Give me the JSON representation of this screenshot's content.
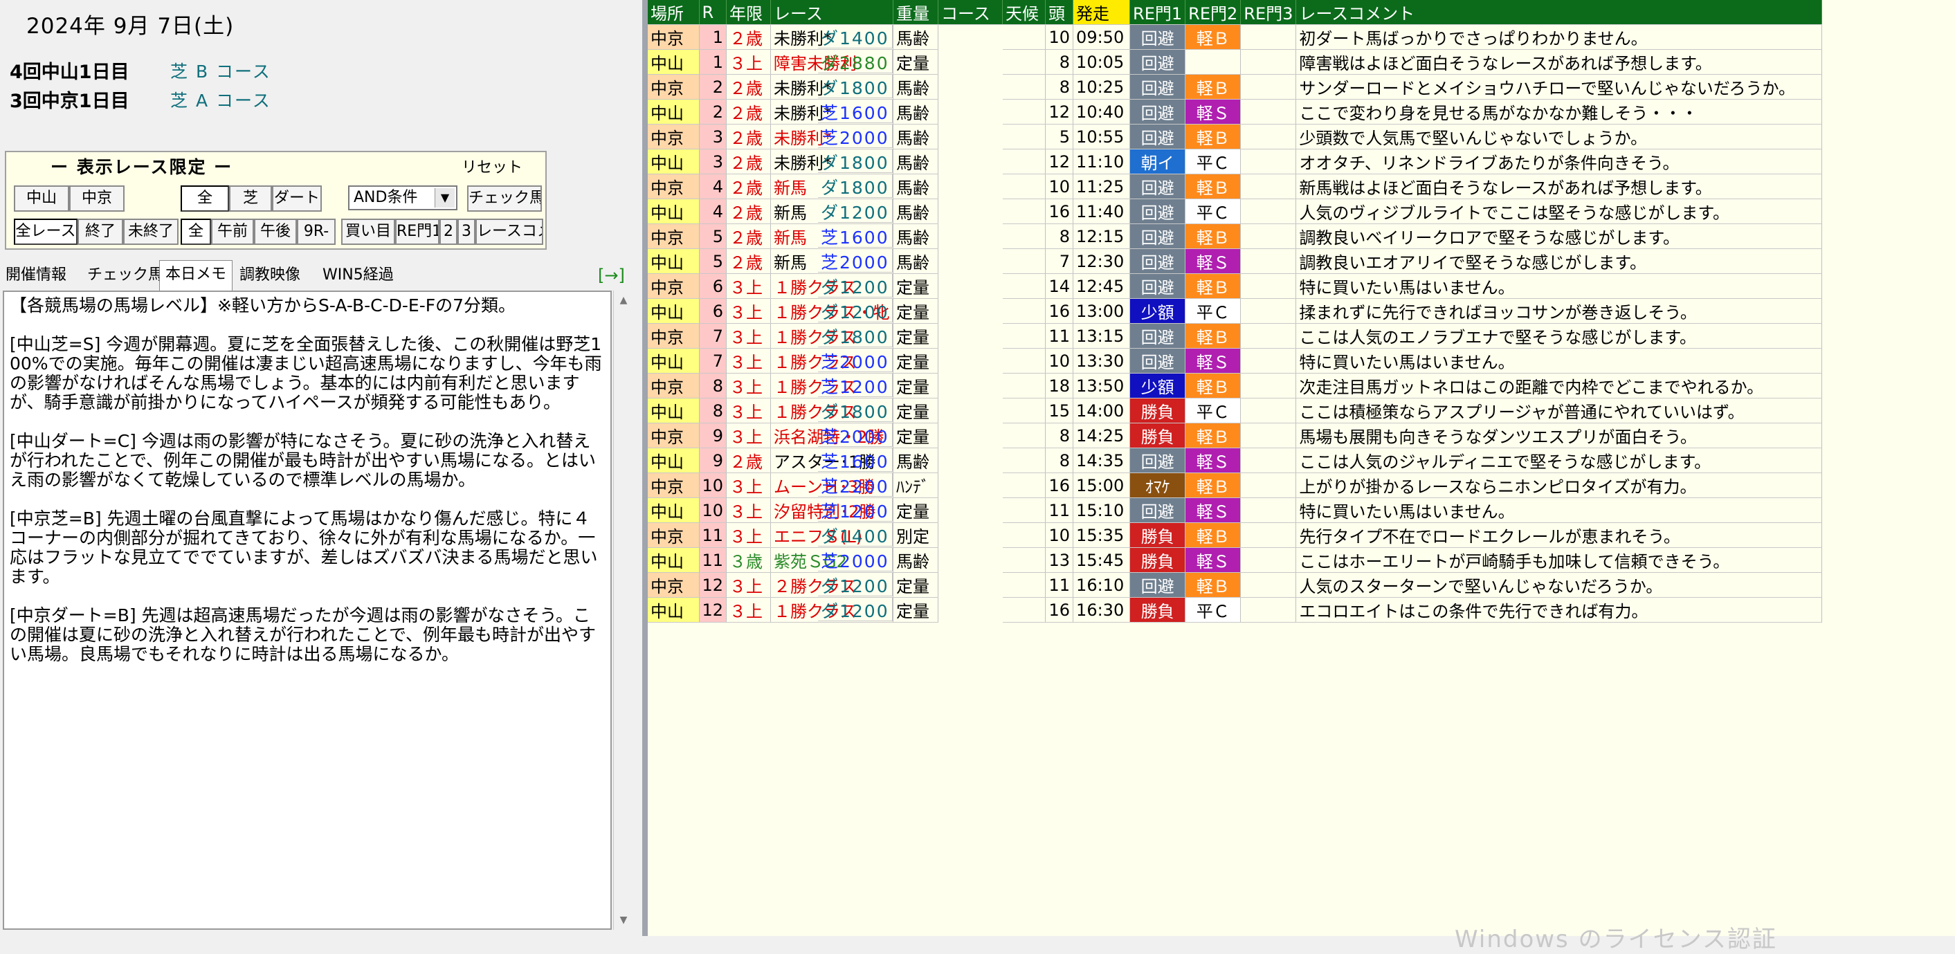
{
  "left": {
    "date": "2024年 9月 7日(土)",
    "venues": [
      {
        "name": "4回中山1日目",
        "course": "芝 B コース"
      },
      {
        "name": "3回中京1日目",
        "course": "芝 A コース"
      }
    ],
    "filter": {
      "title": "ー 表示レース限定 ー",
      "reset": "リセット",
      "row1": [
        "中山",
        "中京",
        "全",
        "芝",
        "ダート",
        "チェック馬"
      ],
      "and_select": "AND条件",
      "row2": [
        "全レース",
        "終了",
        "未終了",
        "全",
        "午前",
        "午後",
        "9R-",
        "買い目",
        "RE門1",
        "2",
        "3",
        "レースコメ"
      ]
    },
    "tabs": [
      "開催情報",
      "チェック馬",
      "本日メモ",
      "調教映像",
      "WIN5経過"
    ],
    "tab_arrow": "[→]",
    "memo": [
      "【各競馬場の馬場レベル】※軽い方からS-A-B-C-D-E-Fの7分類。",
      "[中山芝=S] 今週が開幕週。夏に芝を全面張替えした後、この秋開催は野芝100%での実施。毎年この開催は凄まじい超高速馬場になりますし、今年も雨の影響がなければそんな馬場でしょう。基本的には内前有利だと思いますが、騎手意識が前掛かりになってハイペースが頻発する可能性もあり。",
      "[中山ダート=C] 今週は雨の影響が特になさそう。夏に砂の洗浄と入れ替えが行われたことで、例年この開催が最も時計が出やすい馬場になる。とはいえ雨の影響がなくて乾燥しているので標準レベルの馬場か。",
      "",
      "[中京芝=B] 先週土曜の台風直撃によって馬場はかなり傷んだ感じ。特に４コーナーの内側部分が掘れてきており、徐々に外が有利な馬場になるか。一応はフラットな見立てででていますが、差しはズバズバ決まる馬場だと思います。",
      "[中京ダート=B] 先週は超高速馬場だったが今週は雨の影響がなさそう。この開催は夏に砂の洗浄と入れ替えが行われたことで、例年最も時計が出やすい馬場。良馬場でもそれなりに時計は出る馬場になるか。"
    ]
  },
  "table": {
    "headers": [
      "場所",
      "R",
      "年限",
      "レース",
      "重量",
      "コース",
      "天候",
      "頭",
      "発走",
      "RE門1",
      "RE門2",
      "RE門3",
      "レースコメント"
    ],
    "rows": [
      {
        "place": "中京",
        "r": "1",
        "age": "２歳",
        "race": "未勝利*",
        "weight": "馬齢",
        "course": "ダ1400",
        "weather": "",
        "heads": "10",
        "time": "09:50",
        "p1": "回避",
        "p2": "軽Ｂ",
        "p3": "",
        "comment": "初ダート馬ばっかりでさっぱりわかりません。"
      },
      {
        "place": "中山",
        "r": "1",
        "age": "３上",
        "race": "障害未勝利",
        "weight": "定量",
        "course": "ダ2880",
        "weather": "",
        "heads": "8",
        "time": "10:05",
        "p1": "回避",
        "p2": "",
        "p3": "",
        "comment": "障害戦はよほど面白そうなレースがあれば予想します。"
      },
      {
        "place": "中京",
        "r": "2",
        "age": "２歳",
        "race": "未勝利*",
        "weight": "馬齢",
        "course": "ダ1800",
        "weather": "",
        "heads": "8",
        "time": "10:25",
        "p1": "回避",
        "p2": "軽Ｂ",
        "p3": "",
        "comment": "サンダーロードとメイショウハチローで堅いんじゃないだろうか。"
      },
      {
        "place": "中山",
        "r": "2",
        "age": "２歳",
        "race": "未勝利*",
        "weight": "馬齢",
        "course": "芝1600",
        "weather": "",
        "heads": "12",
        "time": "10:40",
        "p1": "回避",
        "p2": "軽Ｓ",
        "p3": "",
        "comment": "ここで変わり身を見せる馬がなかなか難しそう・・・"
      },
      {
        "place": "中京",
        "r": "3",
        "age": "２歳",
        "race": "未勝利*",
        "weight": "馬齢",
        "course": "芝2000",
        "weather": "",
        "heads": "5",
        "time": "10:55",
        "p1": "回避",
        "p2": "軽Ｂ",
        "p3": "",
        "comment": "少頭数で人気馬で堅いんじゃないでしょうか。"
      },
      {
        "place": "中山",
        "r": "3",
        "age": "２歳",
        "race": "未勝利*",
        "weight": "馬齢",
        "course": "ダ1800",
        "weather": "",
        "heads": "12",
        "time": "11:10",
        "p1": "朝イ",
        "p2": "平Ｃ",
        "p3": "",
        "comment": "オオタチ、リネンドライブあたりが条件向きそう。"
      },
      {
        "place": "中京",
        "r": "4",
        "age": "２歳",
        "race": "新馬",
        "weight": "馬齢",
        "course": "ダ1800",
        "weather": "",
        "heads": "10",
        "time": "11:25",
        "p1": "回避",
        "p2": "軽Ｂ",
        "p3": "",
        "comment": "新馬戦はよほど面白そうなレースがあれば予想します。"
      },
      {
        "place": "中山",
        "r": "4",
        "age": "２歳",
        "race": "新馬",
        "weight": "馬齢",
        "course": "ダ1200",
        "weather": "",
        "heads": "16",
        "time": "11:40",
        "p1": "回避",
        "p2": "平Ｃ",
        "p3": "",
        "comment": "人気のヴィジブルライトでここは堅そうな感じがします。"
      },
      {
        "place": "中京",
        "r": "5",
        "age": "２歳",
        "race": "新馬",
        "weight": "馬齢",
        "course": "芝1600",
        "weather": "",
        "heads": "8",
        "time": "12:15",
        "p1": "回避",
        "p2": "軽Ｂ",
        "p3": "",
        "comment": "調教良いベイリークロアで堅そうな感じがします。"
      },
      {
        "place": "中山",
        "r": "5",
        "age": "２歳",
        "race": "新馬",
        "weight": "馬齢",
        "course": "芝2000",
        "weather": "",
        "heads": "7",
        "time": "12:30",
        "p1": "回避",
        "p2": "軽Ｓ",
        "p3": "",
        "comment": "調教良いエオアリイで堅そうな感じがします。"
      },
      {
        "place": "中京",
        "r": "6",
        "age": "３上",
        "race": "１勝クラス",
        "weight": "定量",
        "course": "ダ1200",
        "weather": "",
        "heads": "14",
        "time": "12:45",
        "p1": "回避",
        "p2": "軽Ｂ",
        "p3": "",
        "comment": "特に買いたい馬はいません。"
      },
      {
        "place": "中山",
        "r": "6",
        "age": "３上",
        "race": "１勝クラス・牝",
        "weight": "定量",
        "course": "ダ1200",
        "weather": "",
        "heads": "16",
        "time": "13:00",
        "p1": "少額",
        "p2": "平Ｃ",
        "p3": "",
        "comment": "揉まれずに先行できればヨッコサンが巻き返しそう。"
      },
      {
        "place": "中京",
        "r": "7",
        "age": "３上",
        "race": "１勝クラス",
        "weight": "定量",
        "course": "ダ1800",
        "weather": "",
        "heads": "11",
        "time": "13:15",
        "p1": "回避",
        "p2": "軽Ｂ",
        "p3": "",
        "comment": "ここは人気のエノラブエナで堅そうな感じがします。"
      },
      {
        "place": "中山",
        "r": "7",
        "age": "３上",
        "race": "１勝クラス",
        "weight": "定量",
        "course": "芝2000",
        "weather": "",
        "heads": "10",
        "time": "13:30",
        "p1": "回避",
        "p2": "軽Ｓ",
        "p3": "",
        "comment": "特に買いたい馬はいません。"
      },
      {
        "place": "中京",
        "r": "8",
        "age": "３上",
        "race": "１勝クラス",
        "weight": "定量",
        "course": "芝1200",
        "weather": "",
        "heads": "18",
        "time": "13:50",
        "p1": "少額",
        "p2": "軽Ｂ",
        "p3": "",
        "comment": "次走注目馬ガットネロはこの距離で内枠でどこまでやれるか。"
      },
      {
        "place": "中山",
        "r": "8",
        "age": "３上",
        "race": "１勝クラス",
        "weight": "定量",
        "course": "ダ1800",
        "weather": "",
        "heads": "15",
        "time": "14:00",
        "p1": "勝負",
        "p2": "平Ｃ",
        "p3": "",
        "comment": "ここは積極策ならアスプリージャが普通にやれていいはず。"
      },
      {
        "place": "中京",
        "r": "9",
        "age": "３上",
        "race": "浜名湖特・2勝",
        "weight": "定量",
        "course": "芝2000",
        "weather": "",
        "heads": "8",
        "time": "14:25",
        "p1": "勝負",
        "p2": "軽Ｂ",
        "p3": "",
        "comment": "馬場も展開も向きそうなダンツエスプリが面白そう。"
      },
      {
        "place": "中山",
        "r": "9",
        "age": "２歳",
        "race": "アスター･1勝",
        "weight": "馬齢",
        "course": "芝1600",
        "weather": "",
        "heads": "8",
        "time": "14:35",
        "p1": "回避",
        "p2": "軽Ｓ",
        "p3": "",
        "comment": "ここは人気のジャルディニエで堅そうな感じがします。"
      },
      {
        "place": "中京",
        "r": "10",
        "age": "３上",
        "race": "ムーンＨ･3勝",
        "weight": "ﾊﾝﾃﾞ",
        "course": "芝2200",
        "weather": "",
        "heads": "16",
        "time": "15:00",
        "p1": "ｵﾏｹ",
        "p2": "軽Ｂ",
        "p3": "",
        "comment": "上がりが掛かるレースならニホンピロタイズが有力。"
      },
      {
        "place": "中山",
        "r": "10",
        "age": "３上",
        "race": "汐留特別･2勝",
        "weight": "定量",
        "course": "芝1200",
        "weather": "",
        "heads": "11",
        "time": "15:10",
        "p1": "回避",
        "p2": "軽Ｓ",
        "p3": "",
        "comment": "特に買いたい馬はいません。"
      },
      {
        "place": "中京",
        "r": "11",
        "age": "３上",
        "race": "エニフＳ(L)",
        "weight": "別定",
        "course": "ダ1400",
        "weather": "",
        "heads": "10",
        "time": "15:35",
        "p1": "勝負",
        "p2": "軽Ｂ",
        "p3": "",
        "comment": "先行タイプ不在でロードエクレールが恵まれそう。"
      },
      {
        "place": "中山",
        "r": "11",
        "age": "３歳",
        "race": "紫苑ＳG2",
        "weight": "馬齢",
        "course": "芝2000",
        "weather": "",
        "heads": "13",
        "time": "15:45",
        "p1": "勝負",
        "p2": "軽Ｓ",
        "p3": "",
        "comment": "ここはホーエリートが戸崎騎手も加味して信頼できそう。"
      },
      {
        "place": "中京",
        "r": "12",
        "age": "３上",
        "race": "２勝クラス",
        "weight": "定量",
        "course": "ダ1200",
        "weather": "",
        "heads": "11",
        "time": "16:10",
        "p1": "回避",
        "p2": "軽Ｂ",
        "p3": "",
        "comment": "人気のスターターンで堅いんじゃないだろうか。"
      },
      {
        "place": "中山",
        "r": "12",
        "age": "３上",
        "race": "１勝クラス",
        "weight": "定量",
        "course": "ダ1200",
        "weather": "",
        "heads": "16",
        "time": "16:30",
        "p1": "勝負",
        "p2": "平Ｃ",
        "p3": "",
        "comment": "エコロエイトはこの条件で先行できれば有力。"
      }
    ]
  },
  "watermark": "Windows のライセンス認証"
}
